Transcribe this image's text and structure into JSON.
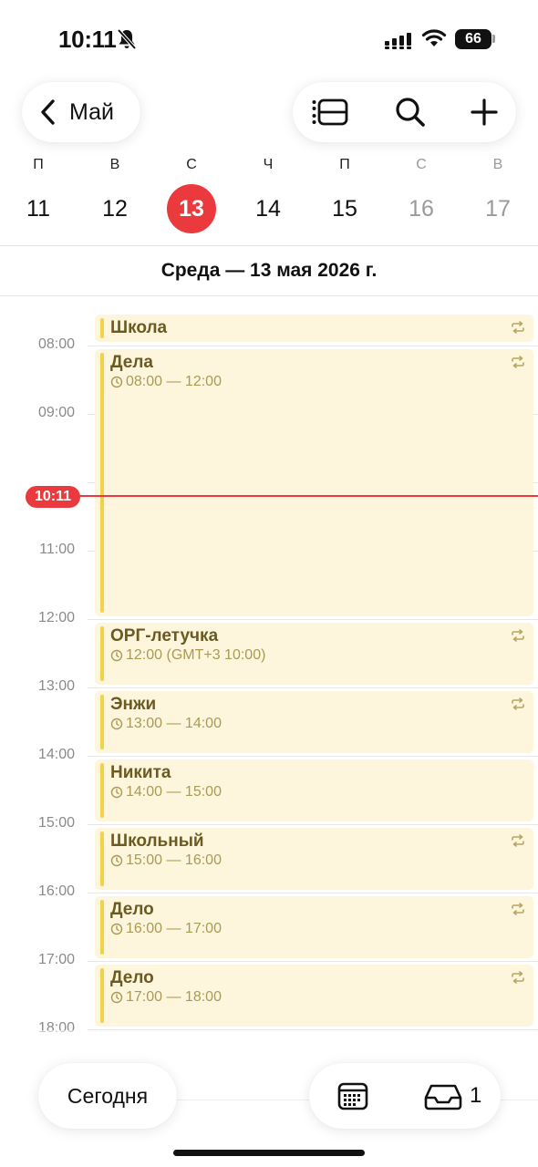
{
  "status_bar": {
    "time": "10:11",
    "battery": "66"
  },
  "header": {
    "back_label": "Май"
  },
  "week": {
    "days": [
      {
        "weekday": "П",
        "date": "11",
        "weekend": false,
        "selected": false
      },
      {
        "weekday": "В",
        "date": "12",
        "weekend": false,
        "selected": false
      },
      {
        "weekday": "С",
        "date": "13",
        "weekend": false,
        "selected": true
      },
      {
        "weekday": "Ч",
        "date": "14",
        "weekend": false,
        "selected": false
      },
      {
        "weekday": "П",
        "date": "15",
        "weekend": false,
        "selected": false
      },
      {
        "weekday": "С",
        "date": "16",
        "weekend": true,
        "selected": false
      },
      {
        "weekday": "В",
        "date": "17",
        "weekend": true,
        "selected": false
      }
    ]
  },
  "date_heading": "Среда — 13 мая 2026 г.",
  "hours": [
    "08:00",
    "09:00",
    "10:00",
    "11:00",
    "12:00",
    "13:00",
    "14:00",
    "15:00",
    "16:00",
    "17:00",
    "18:00"
  ],
  "current_time": "10:11",
  "events": [
    {
      "title": "Школа",
      "time": "",
      "repeat": true
    },
    {
      "title": "Дела",
      "time": "08:00 — 12:00",
      "repeat": true
    },
    {
      "title": "ОРГ-летучка",
      "time": "12:00 (GMT+3 10:00)",
      "repeat": true
    },
    {
      "title": "Энжи",
      "time": "13:00 — 14:00",
      "repeat": true
    },
    {
      "title": "Никита",
      "time": "14:00 — 15:00",
      "repeat": false
    },
    {
      "title": "Школьный",
      "time": "15:00 — 16:00",
      "repeat": true
    },
    {
      "title": "Дело",
      "time": "16:00 — 17:00",
      "repeat": true
    },
    {
      "title": "Дело",
      "time": "17:00 — 18:00",
      "repeat": true
    }
  ],
  "bottom_bar": {
    "today_label": "Сегодня",
    "inbox_count": "1"
  },
  "colors": {
    "accent_red": "#ea3a3d",
    "event_bg": "#fdf6dd",
    "event_bar": "#f2d24b",
    "event_title": "#6b5a22"
  }
}
